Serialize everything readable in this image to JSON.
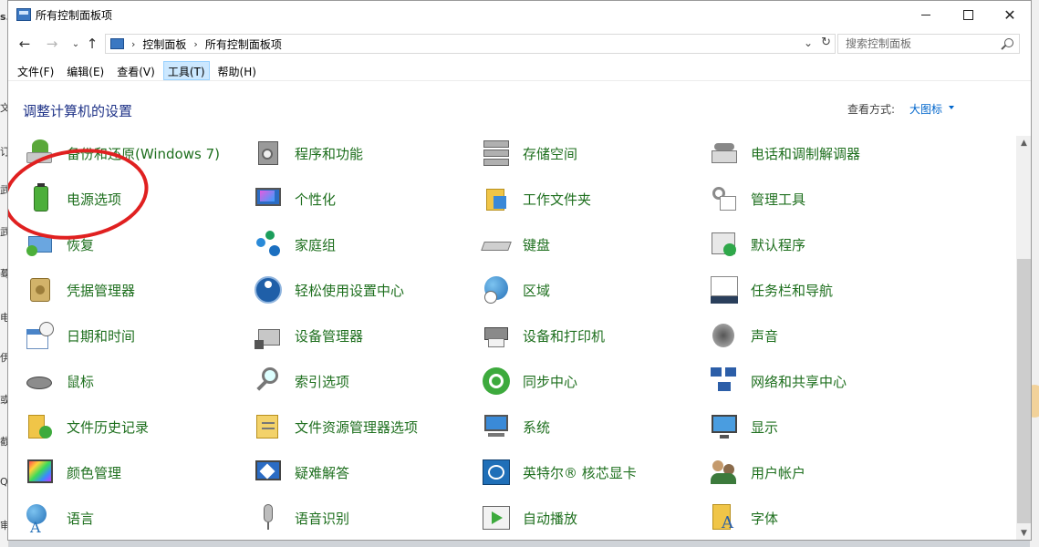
{
  "window": {
    "title": "所有控制面板项"
  },
  "address": {
    "crumbs": [
      "控制面板",
      "所有控制面板项"
    ]
  },
  "search": {
    "placeholder": "搜索控制面板"
  },
  "menu": [
    {
      "label": "文件(F)"
    },
    {
      "label": "编辑(E)"
    },
    {
      "label": "查看(V)"
    },
    {
      "label": "工具(T)",
      "active": true
    },
    {
      "label": "帮助(H)"
    }
  ],
  "header": {
    "title": "调整计算机的设置",
    "view_label": "查看方式:",
    "view_value": "大图标"
  },
  "items": [
    {
      "label": "备份和还原(Windows 7)",
      "icon": "backup-restore-icon"
    },
    {
      "label": "程序和功能",
      "icon": "programs-features-icon"
    },
    {
      "label": "存储空间",
      "icon": "storage-spaces-icon"
    },
    {
      "label": "电话和调制解调器",
      "icon": "phone-modem-icon"
    },
    {
      "label": "电源选项",
      "icon": "power-options-icon"
    },
    {
      "label": "个性化",
      "icon": "personalization-icon"
    },
    {
      "label": "工作文件夹",
      "icon": "work-folders-icon"
    },
    {
      "label": "管理工具",
      "icon": "admin-tools-icon"
    },
    {
      "label": "恢复",
      "icon": "recovery-icon"
    },
    {
      "label": "家庭组",
      "icon": "homegroup-icon"
    },
    {
      "label": "键盘",
      "icon": "keyboard-icon"
    },
    {
      "label": "默认程序",
      "icon": "default-programs-icon"
    },
    {
      "label": "凭据管理器",
      "icon": "credential-manager-icon"
    },
    {
      "label": "轻松使用设置中心",
      "icon": "ease-of-access-icon"
    },
    {
      "label": "区域",
      "icon": "region-icon"
    },
    {
      "label": "任务栏和导航",
      "icon": "taskbar-icon"
    },
    {
      "label": "日期和时间",
      "icon": "date-time-icon"
    },
    {
      "label": "设备管理器",
      "icon": "device-manager-icon"
    },
    {
      "label": "设备和打印机",
      "icon": "devices-printers-icon"
    },
    {
      "label": "声音",
      "icon": "sound-icon"
    },
    {
      "label": "鼠标",
      "icon": "mouse-icon"
    },
    {
      "label": "索引选项",
      "icon": "indexing-options-icon"
    },
    {
      "label": "同步中心",
      "icon": "sync-center-icon"
    },
    {
      "label": "网络和共享中心",
      "icon": "network-sharing-icon"
    },
    {
      "label": "文件历史记录",
      "icon": "file-history-icon"
    },
    {
      "label": "文件资源管理器选项",
      "icon": "explorer-options-icon"
    },
    {
      "label": "系统",
      "icon": "system-icon"
    },
    {
      "label": "显示",
      "icon": "display-icon"
    },
    {
      "label": "颜色管理",
      "icon": "color-management-icon"
    },
    {
      "label": "疑难解答",
      "icon": "troubleshooting-icon"
    },
    {
      "label": "英特尔® 核芯显卡",
      "icon": "intel-graphics-icon"
    },
    {
      "label": "用户帐户",
      "icon": "user-accounts-icon"
    },
    {
      "label": "语言",
      "icon": "language-icon"
    },
    {
      "label": "语音识别",
      "icon": "speech-recognition-icon"
    },
    {
      "label": "自动播放",
      "icon": "autoplay-icon"
    },
    {
      "label": "字体",
      "icon": "fonts-icon"
    }
  ],
  "background_window": {
    "edge_chars": [
      "s.",
      "文",
      "订",
      "武",
      "武",
      "蓦",
      "电",
      "伊",
      "或",
      "截",
      "Q",
      "审"
    ]
  },
  "colors": {
    "item_label": "#1e6f1e",
    "title_blue": "#1e3287",
    "link_blue": "#0066cc",
    "annotation_red": "#e02020"
  }
}
